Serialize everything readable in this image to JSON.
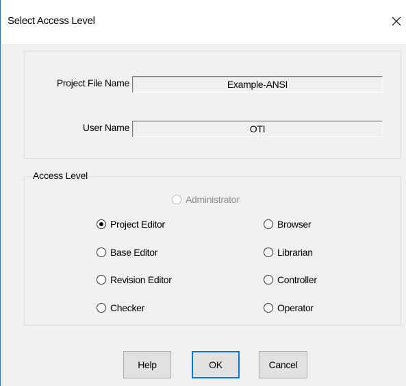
{
  "dialog": {
    "title": "Select Access Level",
    "close_icon": "close-icon"
  },
  "project_info": {
    "project_file_label": "Project File Name",
    "project_file_value": "Example-ANSI",
    "user_name_label": "User Name",
    "user_name_value": "OTI"
  },
  "access_level": {
    "caption": "Access Level",
    "selected": "Project Editor",
    "options": [
      {
        "label": "Administrator",
        "enabled": false,
        "selected": false
      },
      {
        "label": "Project Editor",
        "enabled": true,
        "selected": true
      },
      {
        "label": "Browser",
        "enabled": true,
        "selected": false
      },
      {
        "label": "Base Editor",
        "enabled": true,
        "selected": false
      },
      {
        "label": "Librarian",
        "enabled": true,
        "selected": false
      },
      {
        "label": "Revision Editor",
        "enabled": true,
        "selected": false
      },
      {
        "label": "Controller",
        "enabled": true,
        "selected": false
      },
      {
        "label": "Checker",
        "enabled": true,
        "selected": false
      },
      {
        "label": "Operator",
        "enabled": true,
        "selected": false
      }
    ]
  },
  "buttons": {
    "help": "Help",
    "ok": "OK",
    "cancel": "Cancel"
  },
  "colors": {
    "accent": "#0078d7",
    "window_border": "#1a73e8",
    "face": "#f0f0f0"
  }
}
